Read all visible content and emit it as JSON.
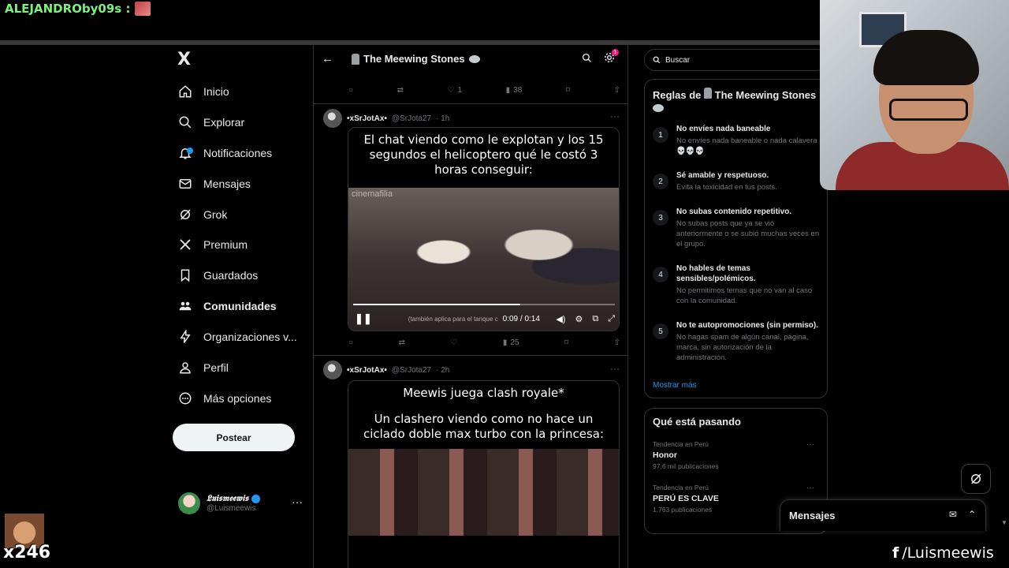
{
  "stream": {
    "chat_user": "ALEJANDROby09s :",
    "counter": "x246",
    "social_handle": "/Luismeewis",
    "social_icon": "facebook-icon"
  },
  "nav": {
    "logo": "X",
    "items": [
      {
        "label": "Inicio",
        "icon": "home-icon"
      },
      {
        "label": "Explorar",
        "icon": "search-icon"
      },
      {
        "label": "Notificaciones",
        "icon": "bell-icon"
      },
      {
        "label": "Mensajes",
        "icon": "mail-icon"
      },
      {
        "label": "Grok",
        "icon": "grok-icon"
      },
      {
        "label": "Premium",
        "icon": "x-premium-icon"
      },
      {
        "label": "Guardados",
        "icon": "bookmark-icon"
      },
      {
        "label": "Comunidades",
        "icon": "communities-icon"
      },
      {
        "label": "Organizaciones v...",
        "icon": "lightning-icon"
      },
      {
        "label": "Perfil",
        "icon": "person-icon"
      },
      {
        "label": "Más opciones",
        "icon": "more-circle-icon"
      }
    ],
    "post_button": "Postear",
    "profile": {
      "name": "𝕷𝖚𝖎𝖘𝖒𝖊𝖊𝖜𝖎𝖘",
      "handle": "@Luismeewis"
    }
  },
  "community": {
    "title": "The Meewing Stones",
    "badge": "1"
  },
  "feed": {
    "prev_actions": {
      "likes": "1",
      "views": "38"
    },
    "tweets": [
      {
        "name": "•xSrJotAx•",
        "handle": "@SrJota27",
        "time": "· 1h",
        "caption": "El chat viendo como le explotan y los 15 segundos el helicoptero qué le costó 3 horas conseguir:",
        "watermark": "cinemafilia",
        "video": {
          "subtitle": "(también aplica para el tanque c",
          "time": "0:09 / 0:14",
          "progress": 0.64
        },
        "actions": {
          "views": "25"
        }
      },
      {
        "name": "•xSrJotAx•",
        "handle": "@SrJota27",
        "time": "· 2h",
        "caption_line1": "Meewis juega clash royale*",
        "caption_line2": "Un clashero viendo como no hace un ciclado doble max turbo con la princesa:"
      }
    ]
  },
  "sidebar": {
    "search_placeholder": "Buscar",
    "rules_title_prefix": "Reglas de",
    "rules_title_suffix": "The Meewing Stones",
    "rules": [
      {
        "num": "1",
        "title": "No envíes nada baneable",
        "desc": "No envíes nada baneable o nada calavera 💀💀💀"
      },
      {
        "num": "2",
        "title": "Sé amable y respetuoso.",
        "desc": "Evita la toxicidad en tus posts."
      },
      {
        "num": "3",
        "title": "No subas contenido repetitivo.",
        "desc": "No subas posts que ya se vió anteriormente o se subió muchas veces en el grupo."
      },
      {
        "num": "4",
        "title": "No hables de temas sensibles/polémicos.",
        "desc": "No permitimos temas que no van al caso con la comunidad."
      },
      {
        "num": "5",
        "title": "No te autopromociones (sin permiso).",
        "desc": "No hagas spam de algún canal, página, marca, sin autorización de la administración."
      }
    ],
    "show_more": "Mostrar más",
    "trends_title": "Qué está pasando",
    "trends": [
      {
        "context": "Tendencia en Perú",
        "name": "Honor",
        "count": "97,6 mil publicaciones"
      },
      {
        "context": "Tendencia en Perú",
        "name": "PERÚ ES CLAVE",
        "count": "1.763 publicaciones"
      }
    ],
    "messages_title": "Mensajes"
  }
}
